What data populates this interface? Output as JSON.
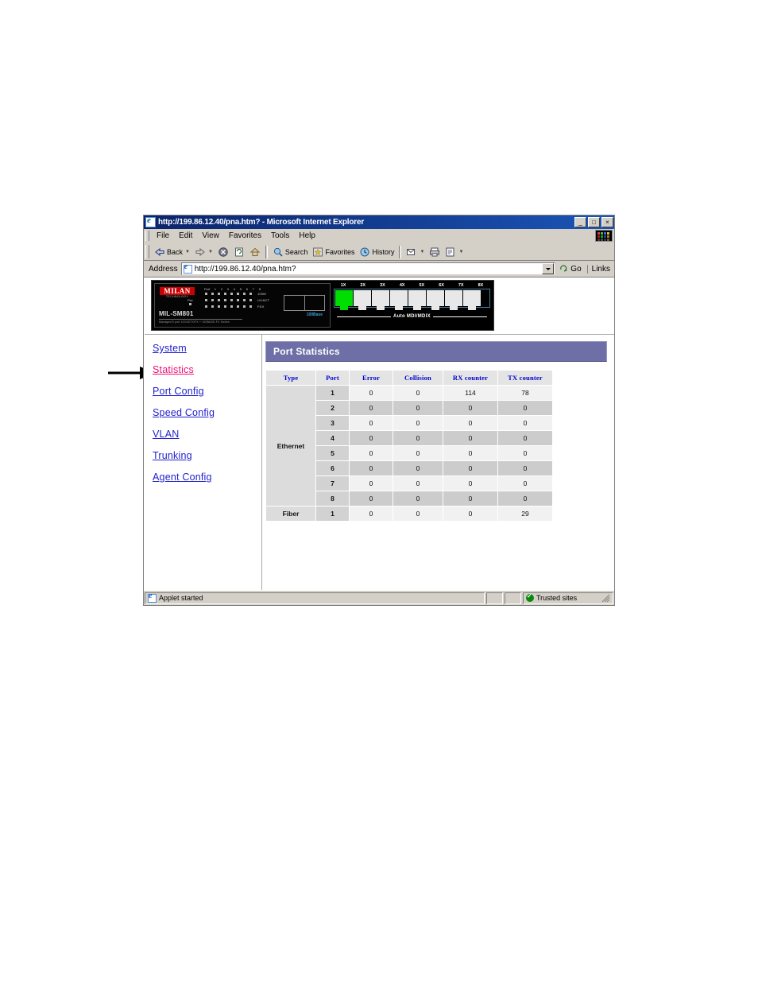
{
  "window": {
    "title": "http://199.86.12.40/pna.htm? - Microsoft Internet Explorer",
    "minimize_label": "_",
    "maximize_label": "□",
    "close_label": "×"
  },
  "menubar": {
    "items": [
      {
        "label": "File"
      },
      {
        "label": "Edit"
      },
      {
        "label": "View"
      },
      {
        "label": "Favorites"
      },
      {
        "label": "Tools"
      },
      {
        "label": "Help"
      }
    ]
  },
  "toolbar": {
    "back_label": "Back",
    "forward_label": "",
    "stop_label": "",
    "refresh_label": "",
    "home_label": "",
    "search_label": "Search",
    "favorites_label": "Favorites",
    "history_label": "History",
    "mail_label": "",
    "print_label": "",
    "edit_label": ""
  },
  "addressbar": {
    "label": "Address",
    "value": "http://199.86.12.40/pna.htm?",
    "placeholder": "http://",
    "go_label": "Go",
    "links_label": "Links"
  },
  "device": {
    "brand": "MILAN",
    "brand_sub": "TECHNOLOGY",
    "model": "MIL-SM801",
    "model_sub": "Managed 8 port 10/100TX/FX + 100BASE-FX Switch",
    "port_header_label": "Port",
    "port_numbers": [
      "1",
      "2",
      "3",
      "4",
      "5",
      "6",
      "7",
      "8"
    ],
    "led_rows": [
      "100M",
      "LK/ACT",
      "FDX"
    ],
    "power_label": "Pwr",
    "sfp_label": "100Base",
    "jacks": [
      "1X",
      "2X",
      "3X",
      "4X",
      "5X",
      "6X",
      "7X",
      "8X"
    ],
    "active_jack": "1X",
    "mdi_label": "Auto MDI/MDIX"
  },
  "nav": {
    "items": [
      {
        "label": "System",
        "state": "link"
      },
      {
        "label": "Statistics",
        "state": "visited"
      },
      {
        "label": "Port Config",
        "state": "link"
      },
      {
        "label": "Speed Config",
        "state": "link"
      },
      {
        "label": "VLAN",
        "state": "link"
      },
      {
        "label": "Trunking",
        "state": "link"
      },
      {
        "label": "Agent Config",
        "state": "link"
      }
    ]
  },
  "panel": {
    "title": "Port Statistics"
  },
  "table": {
    "headers": [
      "Type",
      "Port",
      "Error",
      "Collision",
      "RX counter",
      "TX counter"
    ],
    "group_ethernet": "Ethernet",
    "group_fiber": "Fiber",
    "rows": [
      {
        "type": "Ethernet",
        "port": "1",
        "error": "0",
        "collision": "0",
        "rx": "114",
        "tx": "78"
      },
      {
        "type": "Ethernet",
        "port": "2",
        "error": "0",
        "collision": "0",
        "rx": "0",
        "tx": "0"
      },
      {
        "type": "Ethernet",
        "port": "3",
        "error": "0",
        "collision": "0",
        "rx": "0",
        "tx": "0"
      },
      {
        "type": "Ethernet",
        "port": "4",
        "error": "0",
        "collision": "0",
        "rx": "0",
        "tx": "0"
      },
      {
        "type": "Ethernet",
        "port": "5",
        "error": "0",
        "collision": "0",
        "rx": "0",
        "tx": "0"
      },
      {
        "type": "Ethernet",
        "port": "6",
        "error": "0",
        "collision": "0",
        "rx": "0",
        "tx": "0"
      },
      {
        "type": "Ethernet",
        "port": "7",
        "error": "0",
        "collision": "0",
        "rx": "0",
        "tx": "0"
      },
      {
        "type": "Ethernet",
        "port": "8",
        "error": "0",
        "collision": "0",
        "rx": "0",
        "tx": "0"
      },
      {
        "type": "Fiber",
        "port": "1",
        "error": "0",
        "collision": "0",
        "rx": "0",
        "tx": "29"
      }
    ]
  },
  "statusbar": {
    "message": "Applet started",
    "zone": "Trusted sites"
  },
  "colors": {
    "titlebar": "#0a246a",
    "panel_header": "#6f6fa8",
    "link": "#2222cc",
    "visited_link": "#ee1177",
    "table_header_text": "#0000d0",
    "port_number": "#ee0000",
    "active_port_led": "#00dd00"
  }
}
